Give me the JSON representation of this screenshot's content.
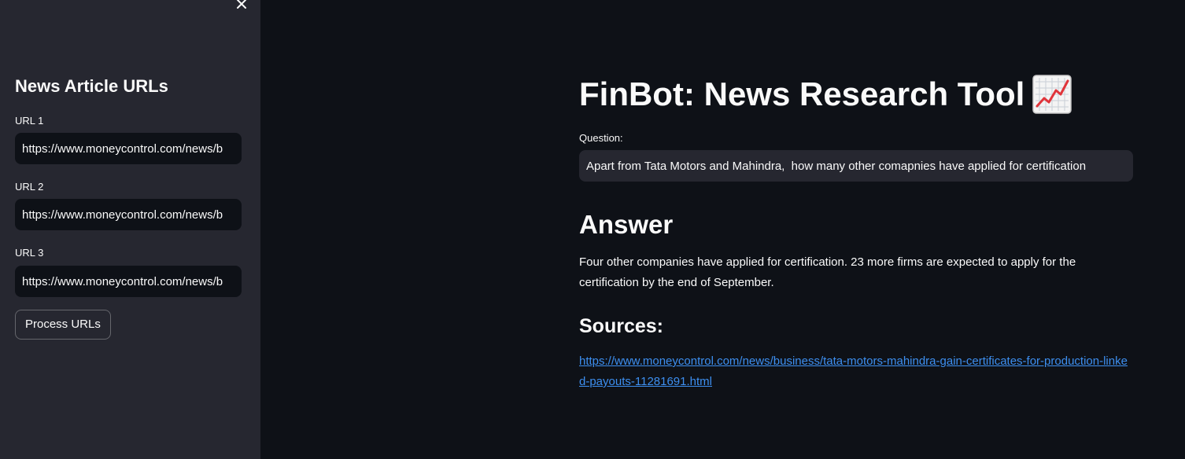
{
  "sidebar": {
    "title": "News Article URLs",
    "close_icon": "close-icon",
    "urls": [
      {
        "label": "URL 1",
        "value": "https://www.moneycontrol.com/news/b"
      },
      {
        "label": "URL 2",
        "value": "https://www.moneycontrol.com/news/b"
      },
      {
        "label": "URL 3",
        "value": "https://www.moneycontrol.com/news/b"
      }
    ],
    "process_button": "Process URLs"
  },
  "main": {
    "title": "FinBot: News Research Tool",
    "title_icon": "chart-increasing-icon",
    "question_label": "Question:",
    "question_value": "Apart from Tata Motors and Mahindra,  how many other comapnies have applied for certification",
    "answer_heading": "Answer",
    "answer_text": "Four other companies have applied for certification. 23 more firms are expected to apply for the certification by the end of September.",
    "sources_heading": "Sources:",
    "source_link": "https://www.moneycontrol.com/news/business/tata-motors-mahindra-gain-certificates-for-production-linked-payouts-11281691.html"
  },
  "colors": {
    "main_background": "#0e1117",
    "sidebar_background": "#262730",
    "text": "#fafafa",
    "link": "#3d8ff0"
  }
}
